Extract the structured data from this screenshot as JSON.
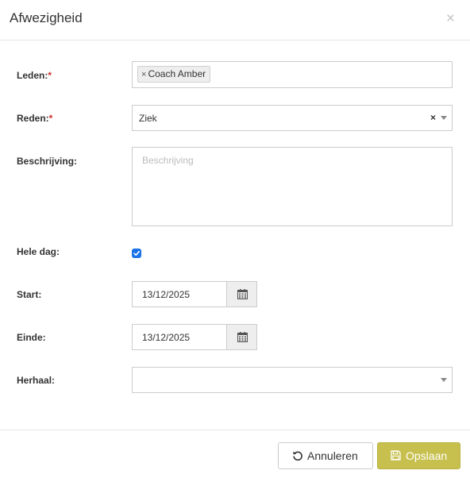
{
  "dialog": {
    "title": "Afwezigheid",
    "close_glyph": "×"
  },
  "form": {
    "members": {
      "label": "Leden:",
      "required_mark": "*",
      "tags": [
        {
          "label": "Coach Amber",
          "remove_glyph": "×"
        }
      ]
    },
    "reason": {
      "label": "Reden:",
      "required_mark": "*",
      "value": "Ziek",
      "clear_glyph": "×"
    },
    "description": {
      "label": "Beschrijving:",
      "placeholder": "Beschrijving",
      "value": ""
    },
    "all_day": {
      "label": "Hele dag:",
      "checked": true
    },
    "start": {
      "label": "Start:",
      "value": "13/12/2025",
      "icon": "calendar-icon"
    },
    "end": {
      "label": "Einde:",
      "value": "13/12/2025",
      "icon": "calendar-icon"
    },
    "repeat": {
      "label": "Herhaal:",
      "value": ""
    }
  },
  "footer": {
    "cancel_label": "Annuleren",
    "cancel_icon": "undo-icon",
    "save_label": "Opslaan",
    "save_icon": "floppy-disk-icon"
  },
  "colors": {
    "required": "#c9302c",
    "checkbox": "#1a73e8",
    "save_button": "#c7c04f"
  }
}
